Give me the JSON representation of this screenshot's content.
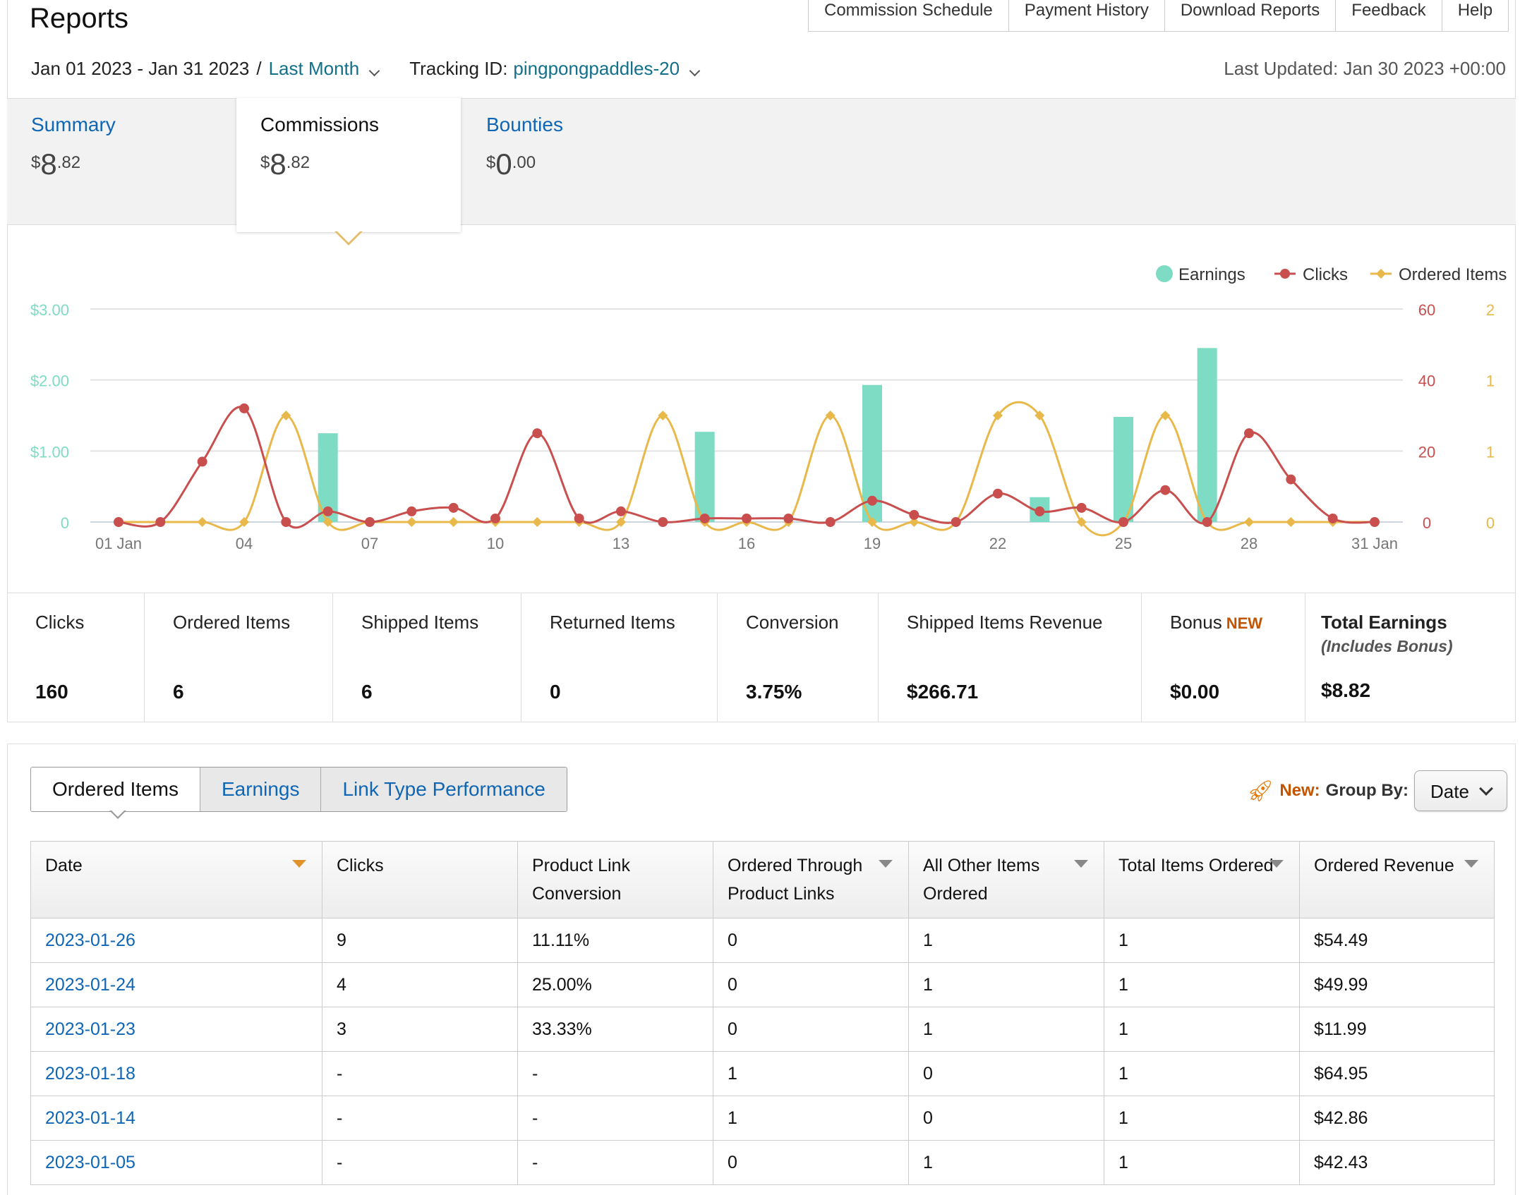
{
  "header": {
    "title": "Reports",
    "links": [
      "Commission Schedule",
      "Payment History",
      "Download Reports",
      "Feedback",
      "Help"
    ],
    "date_range": "Jan 01 2023 - Jan 31 2023",
    "date_sep": "/",
    "period": "Last Month",
    "tracking_label": "Tracking ID:",
    "tracking_id": "pingpongpaddles-20",
    "last_updated": "Last Updated: Jan 30 2023 +00:00"
  },
  "summary_tabs": [
    {
      "label": "Summary",
      "currency": "$",
      "whole": "8",
      "cents": ".82"
    },
    {
      "label": "Commissions",
      "currency": "$",
      "whole": "8",
      "cents": ".82"
    },
    {
      "label": "Bounties",
      "currency": "$",
      "whole": "0",
      "cents": ".00"
    }
  ],
  "colors": {
    "earnings": "#7fdcc4",
    "clicks": "#c94f4f",
    "ordered": "#e8b94a",
    "link": "#0f66b5",
    "accent": "#c45500"
  },
  "chart_data": {
    "type": "bar+line",
    "legend": [
      "Earnings",
      "Clicks",
      "Ordered Items"
    ],
    "legend_position": "top-right",
    "x": [
      "01 Jan",
      "02",
      "03",
      "04",
      "05",
      "06",
      "07",
      "08",
      "09",
      "10",
      "11",
      "12",
      "13",
      "14",
      "15",
      "16",
      "17",
      "18",
      "19",
      "20",
      "21",
      "22",
      "23",
      "24",
      "25",
      "26",
      "27",
      "28",
      "29",
      "30",
      "31 Jan"
    ],
    "x_tick_labels": [
      "01 Jan",
      "04",
      "07",
      "10",
      "13",
      "16",
      "19",
      "22",
      "25",
      "28",
      "31 Jan"
    ],
    "series": [
      {
        "name": "Earnings",
        "type": "bar",
        "axis": "left",
        "values": [
          0,
          0,
          0,
          0,
          0,
          1.25,
          0,
          0,
          0,
          0,
          0,
          0,
          0,
          0,
          1.27,
          0,
          0,
          0,
          1.93,
          0,
          0,
          0,
          0.35,
          0,
          1.48,
          0,
          2.45,
          0,
          0,
          0,
          0
        ]
      },
      {
        "name": "Clicks",
        "type": "line",
        "axis": "right",
        "values": [
          0,
          0,
          17,
          32,
          0,
          3,
          0,
          3,
          4,
          1,
          25,
          1,
          3,
          0,
          1,
          1,
          1,
          0,
          6,
          2,
          0,
          8,
          3,
          4,
          0,
          9,
          0,
          25,
          12,
          1,
          0
        ]
      },
      {
        "name": "Ordered Items",
        "type": "line",
        "axis": "right2",
        "values": [
          0,
          0,
          0,
          0,
          1,
          0,
          0,
          0,
          0,
          0,
          0,
          0,
          0,
          1,
          0,
          0,
          0,
          1,
          0,
          0,
          0,
          1,
          1,
          0,
          0,
          1,
          0,
          0,
          0,
          0,
          0
        ]
      }
    ],
    "y_left": {
      "ticks": [
        "0",
        "$1.00",
        "$2.00",
        "$3.00"
      ],
      "range": [
        0,
        3
      ]
    },
    "y_right": {
      "ticks": [
        "0",
        "20",
        "40",
        "60"
      ],
      "range": [
        0,
        60
      ]
    },
    "y_right2": {
      "ticks": [
        "0",
        "1",
        "1",
        "2"
      ],
      "range": [
        0,
        2
      ]
    },
    "grid": true
  },
  "stats": [
    {
      "label": "Clicks",
      "value": "160"
    },
    {
      "label": "Ordered Items",
      "value": "6"
    },
    {
      "label": "Shipped Items",
      "value": "6"
    },
    {
      "label": "Returned Items",
      "value": "0"
    },
    {
      "label": "Conversion",
      "value": "3.75%"
    },
    {
      "label": "Shipped Items Revenue",
      "value": "$266.71"
    },
    {
      "label": "Bonus",
      "badge": "NEW",
      "value": "$0.00"
    },
    {
      "label": "Total Earnings",
      "sub": "(Includes Bonus)",
      "value": "$8.82"
    }
  ],
  "table_tabs": [
    "Ordered Items",
    "Earnings",
    "Link Type Performance"
  ],
  "group_by": {
    "new_label": "New:",
    "label": "Group By:",
    "value": "Date"
  },
  "table": {
    "columns": [
      "Date",
      "Clicks",
      "Product Link Conversion",
      "Ordered Through Product Links",
      "All Other Items Ordered",
      "Total Items Ordered",
      "Ordered Revenue"
    ],
    "rows": [
      [
        "2023-01-26",
        "9",
        "11.11%",
        "0",
        "1",
        "1",
        "$54.49"
      ],
      [
        "2023-01-24",
        "4",
        "25.00%",
        "0",
        "1",
        "1",
        "$49.99"
      ],
      [
        "2023-01-23",
        "3",
        "33.33%",
        "0",
        "1",
        "1",
        "$11.99"
      ],
      [
        "2023-01-18",
        "-",
        "-",
        "1",
        "0",
        "1",
        "$64.95"
      ],
      [
        "2023-01-14",
        "-",
        "-",
        "1",
        "0",
        "1",
        "$42.86"
      ],
      [
        "2023-01-05",
        "-",
        "-",
        "0",
        "1",
        "1",
        "$42.43"
      ]
    ]
  }
}
